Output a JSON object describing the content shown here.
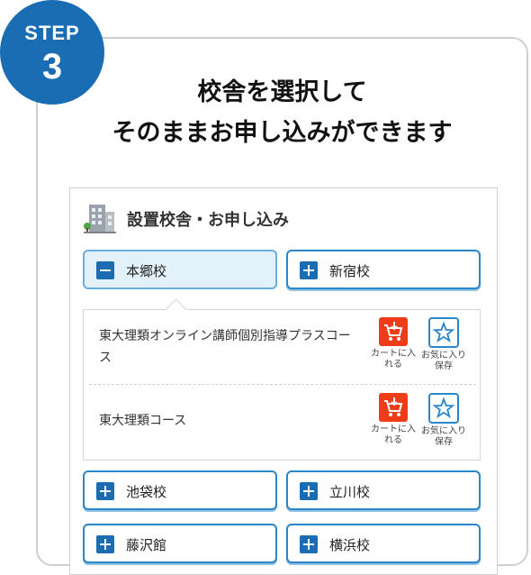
{
  "step": {
    "word": "STEP",
    "number": "3"
  },
  "headline": {
    "line1": "校舎を選択して",
    "line2": "そのままお申し込みができます"
  },
  "panel": {
    "title": "設置校舎・お申し込み",
    "icon": "building-icon"
  },
  "campuses": [
    {
      "label": "本郷校",
      "state": "expanded"
    },
    {
      "label": "新宿校",
      "state": "collapsed"
    },
    {
      "label": "池袋校",
      "state": "collapsed"
    },
    {
      "label": "立川校",
      "state": "collapsed"
    },
    {
      "label": "藤沢館",
      "state": "collapsed"
    },
    {
      "label": "横浜校",
      "state": "collapsed"
    }
  ],
  "courses": [
    {
      "name": "東大理類オンライン講師個別指導プラスコース",
      "cart_label": "カートに入れる",
      "fav_label": "お気に入り保存"
    },
    {
      "name": "東大理類コース",
      "cart_label": "カートに入れる",
      "fav_label": "お気に入り保存"
    }
  ],
  "colors": {
    "brand_blue": "#1a6cb3",
    "button_border": "#2b86c9",
    "active_bg": "#e3f1fa",
    "cart_red": "#ec3d18"
  }
}
